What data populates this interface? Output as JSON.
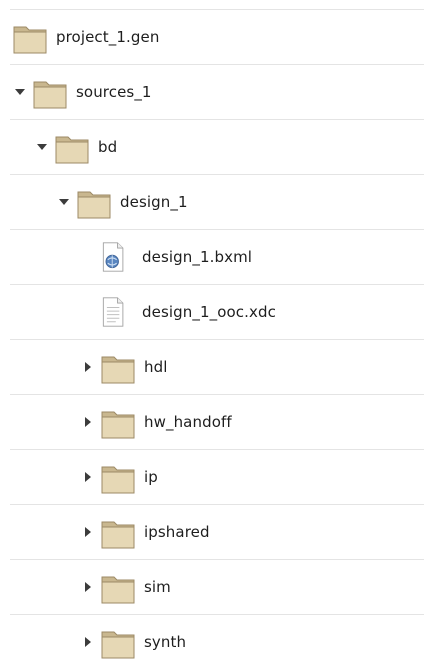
{
  "tree": {
    "rows": [
      {
        "label": "project_1.gen",
        "icon": "folder-icon",
        "expander": "none"
      },
      {
        "label": "sources_1",
        "icon": "folder-icon",
        "expander": "open"
      },
      {
        "label": "bd",
        "icon": "folder-icon",
        "expander": "open"
      },
      {
        "label": "design_1",
        "icon": "folder-icon",
        "expander": "open"
      },
      {
        "label": "design_1.bxml",
        "icon": "xml-file-icon",
        "expander": "none"
      },
      {
        "label": "design_1_ooc.xdc",
        "icon": "text-file-icon",
        "expander": "none"
      },
      {
        "label": "hdl",
        "icon": "folder-icon",
        "expander": "closed"
      },
      {
        "label": "hw_handoff",
        "icon": "folder-icon",
        "expander": "closed"
      },
      {
        "label": "ip",
        "icon": "folder-icon",
        "expander": "closed"
      },
      {
        "label": "ipshared",
        "icon": "folder-icon",
        "expander": "closed"
      },
      {
        "label": "sim",
        "icon": "folder-icon",
        "expander": "closed"
      },
      {
        "label": "synth",
        "icon": "folder-icon",
        "expander": "closed"
      }
    ]
  }
}
